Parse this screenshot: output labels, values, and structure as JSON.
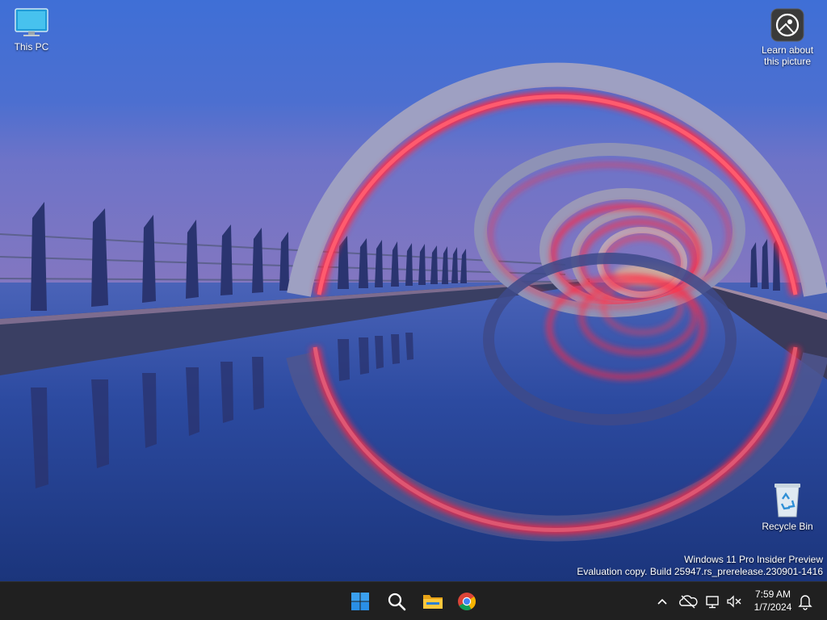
{
  "desktop": {
    "icons": [
      {
        "label": "This PC"
      },
      {
        "label": "Learn about this picture"
      },
      {
        "label": "Recycle Bin"
      }
    ],
    "watermark": {
      "line1": "Windows 11 Pro Insider Preview",
      "line2": "Evaluation copy. Build 25947.rs_prerelease.230901-1416"
    }
  },
  "taskbar": {
    "apps": [
      {
        "icon": "windows-start-icon"
      },
      {
        "icon": "search-icon"
      },
      {
        "icon": "file-explorer-icon"
      },
      {
        "icon": "chrome-icon"
      }
    ],
    "tray": {
      "icons": [
        "chevron-up-icon",
        "onedrive-offline-icon",
        "network-icon",
        "volume-muted-icon",
        "notification-bell-icon"
      ],
      "time": "7:59 AM",
      "date": "1/7/2024"
    }
  },
  "colors": {
    "taskbar_bg": "#202020",
    "ring_glow": "#ff2a45",
    "sky_top": "#3f6fd6",
    "water": "#203f8a"
  }
}
